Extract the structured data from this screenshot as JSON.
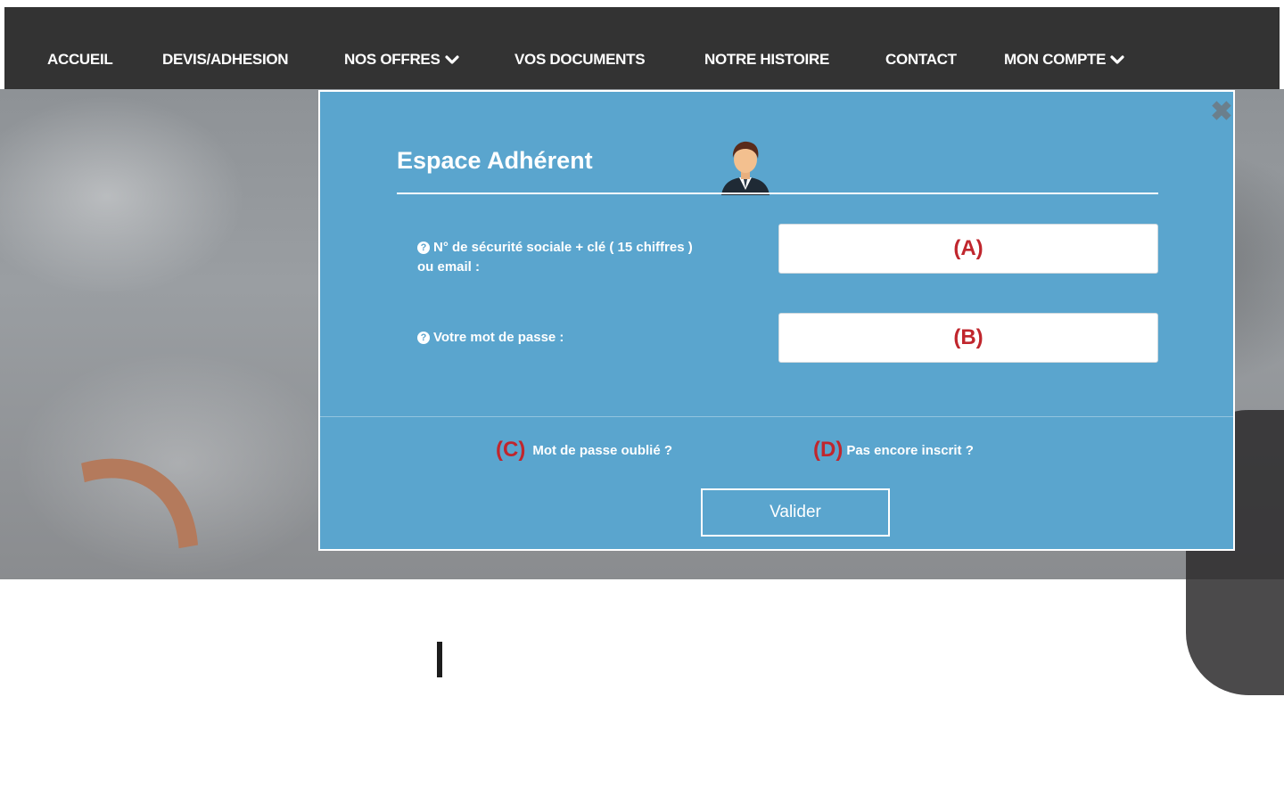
{
  "nav": {
    "items": [
      {
        "label": "ACCUEIL"
      },
      {
        "label": "DEVIS/ADHESION"
      },
      {
        "label": "NOS OFFRES"
      },
      {
        "label": "VOS DOCUMENTS"
      },
      {
        "label": "NOTRE HISTOIRE"
      },
      {
        "label": "CONTACT"
      },
      {
        "label": "MON COMPTE"
      }
    ]
  },
  "modal": {
    "title": "Espace Adhérent",
    "close_icon": "close-icon",
    "fields": {
      "id_label_line1": "N° de sécurité sociale + clé ( 15 chiffres )",
      "id_label_line2": "ou email :",
      "id_marker": "(A)",
      "password_label": "Votre mot de passe :",
      "password_marker": "(B)"
    },
    "links": {
      "forgot_marker": "(C)",
      "forgot_label": "Mot de passe oublié ?",
      "register_marker": "(D)",
      "register_label": "Pas encore inscrit ?"
    },
    "submit_label": "Valider"
  },
  "colors": {
    "nav_bg": "#333333",
    "modal_bg": "#5aa5ce",
    "marker": "#c0262d"
  }
}
